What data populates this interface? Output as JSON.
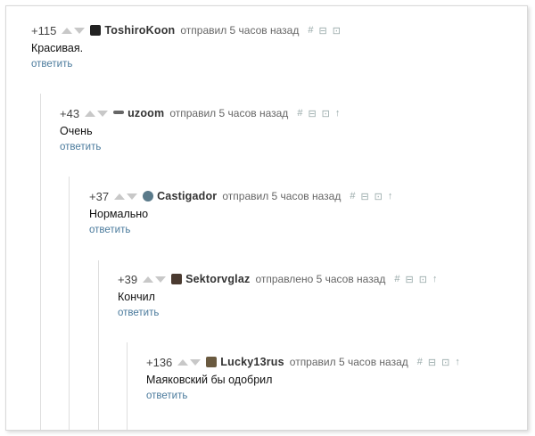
{
  "comments": [
    {
      "score": "+115",
      "user": "ToshiroKoon",
      "meta": "отправил 5 часов назад",
      "text": "Красивая.",
      "reply": "ответить",
      "tools": [
        "#",
        "⊟",
        "⊡"
      ]
    },
    {
      "score": "+43",
      "user": "uzoom",
      "meta": "отправил 5 часов назад",
      "text": "Очень",
      "reply": "ответить",
      "tools": [
        "#",
        "⊟",
        "⊡",
        "↑"
      ]
    },
    {
      "score": "+37",
      "user": "Castigador",
      "meta": "отправил 5 часов назад",
      "text": "Нормально",
      "reply": "ответить",
      "tools": [
        "#",
        "⊟",
        "⊡",
        "↑"
      ]
    },
    {
      "score": "+39",
      "user": "Sektorvglaz",
      "meta": "отправлено 5 часов назад",
      "text": "Кончил",
      "reply": "ответить",
      "tools": [
        "#",
        "⊟",
        "⊡",
        "↑"
      ]
    },
    {
      "score": "+136",
      "user": "Lucky13rus",
      "meta": "отправил 5 часов назад",
      "text": "Маяковский бы одобрил",
      "reply": "ответить",
      "tools": [
        "#",
        "⊟",
        "⊡",
        "↑"
      ]
    }
  ]
}
